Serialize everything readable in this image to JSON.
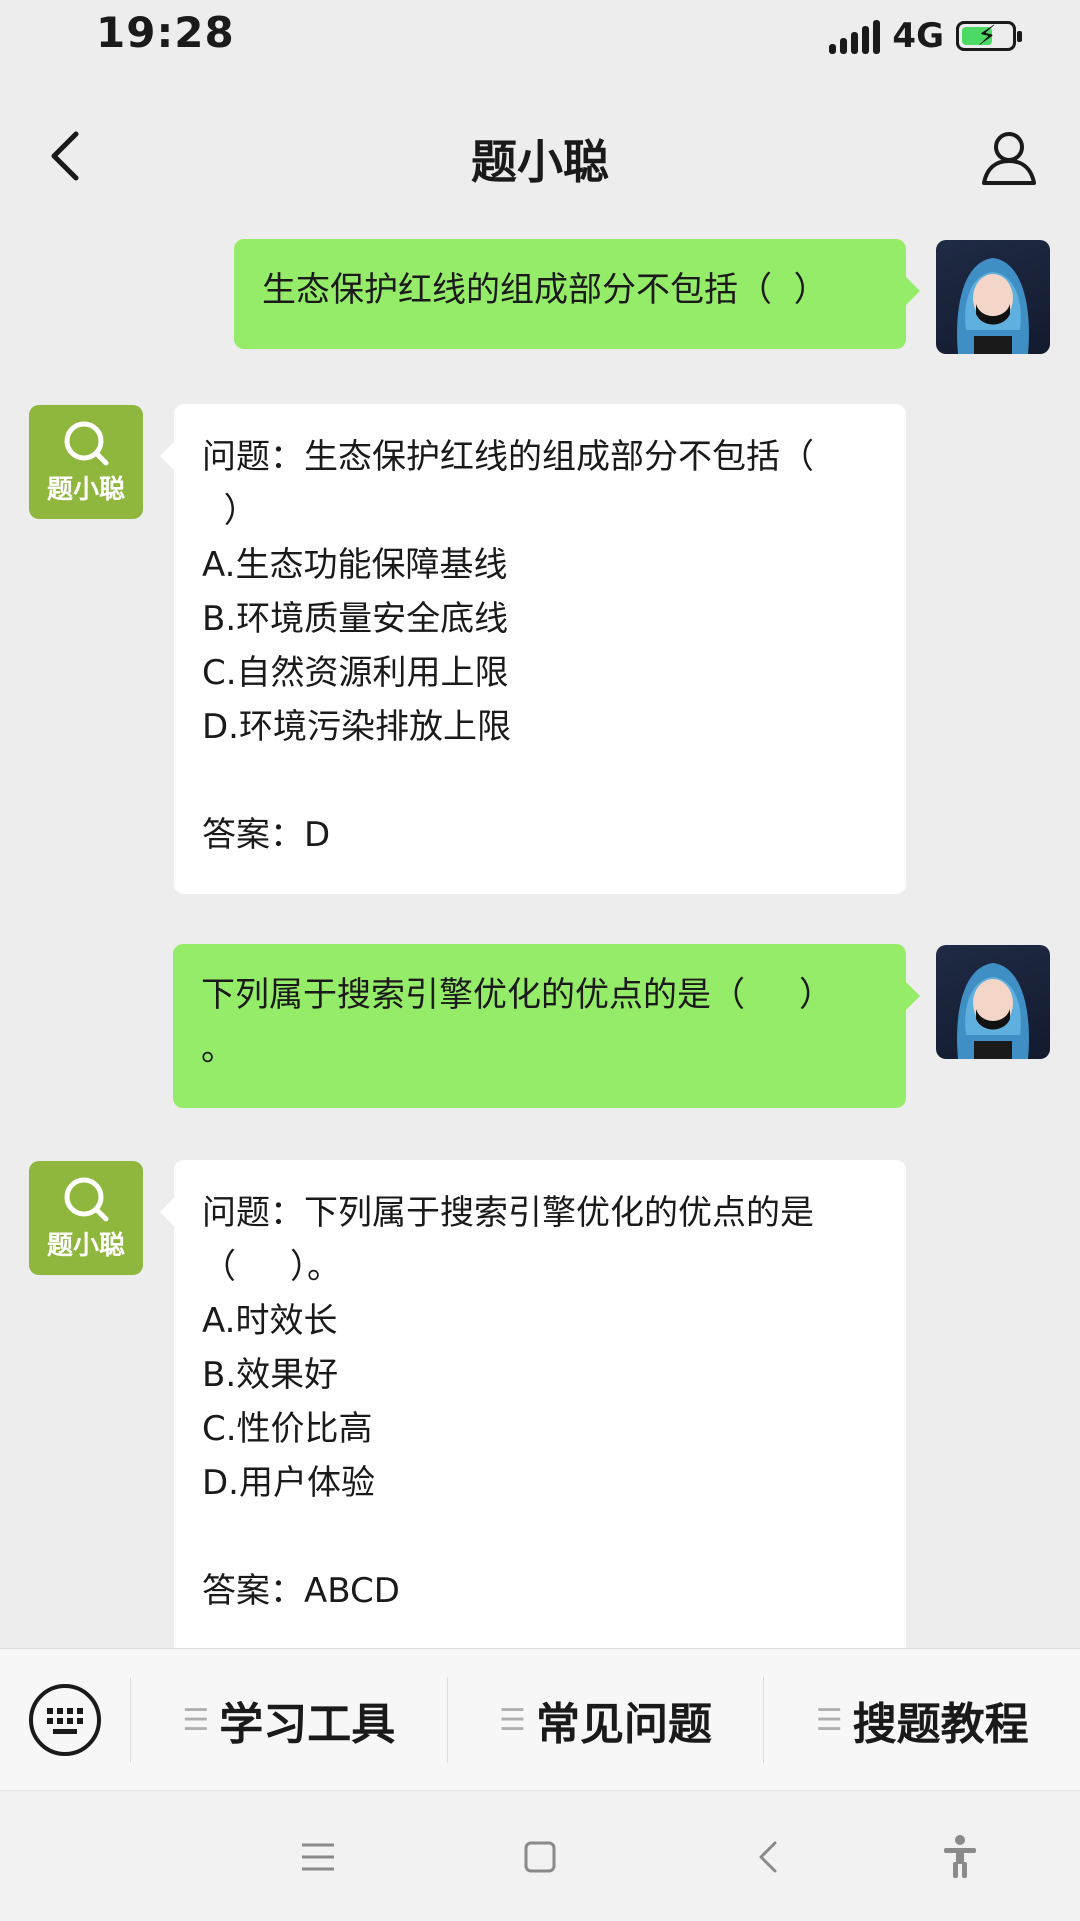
{
  "status_bar": {
    "time": "19:28",
    "network": "4G"
  },
  "nav": {
    "title": "题小聪"
  },
  "messages": [
    {
      "from": "user",
      "lines": [
        "生态保护红线的组成部分不包括（  ）"
      ]
    },
    {
      "from": "bot",
      "avatar_label": "题小聪",
      "lines": [
        "问题：生态保护红线的组成部分不包括（",
        "  ）",
        "A.生态功能保障基线",
        "B.环境质量安全底线",
        "C.自然资源利用上限",
        "D.环境污染排放上限"
      ],
      "answer": "答案：D"
    },
    {
      "from": "user",
      "lines": [
        "下列属于搜索引擎优化的优点的是（     ）",
        "。"
      ]
    },
    {
      "from": "bot",
      "avatar_label": "题小聪",
      "lines": [
        "问题：下列属于搜索引擎优化的优点的是",
        "（     ）。",
        "A.时效长",
        "B.效果好",
        "C.性价比高",
        "D.用户体验"
      ],
      "answer": "答案：ABCD"
    }
  ],
  "menu": {
    "items": [
      {
        "label": "学习工具"
      },
      {
        "label": "常见问题"
      },
      {
        "label": "搜题教程"
      }
    ]
  },
  "colors": {
    "user_bubble": "#95ec69",
    "bot_bubble": "#ffffff",
    "bot_avatar": "#8fb73e",
    "background": "#ededed"
  },
  "icons": [
    "back-arrow-icon",
    "person-icon",
    "search-icon",
    "keyboard-icon",
    "menu-lines-icon",
    "home-square-icon",
    "back-chevron-icon",
    "accessibility-icon"
  ]
}
